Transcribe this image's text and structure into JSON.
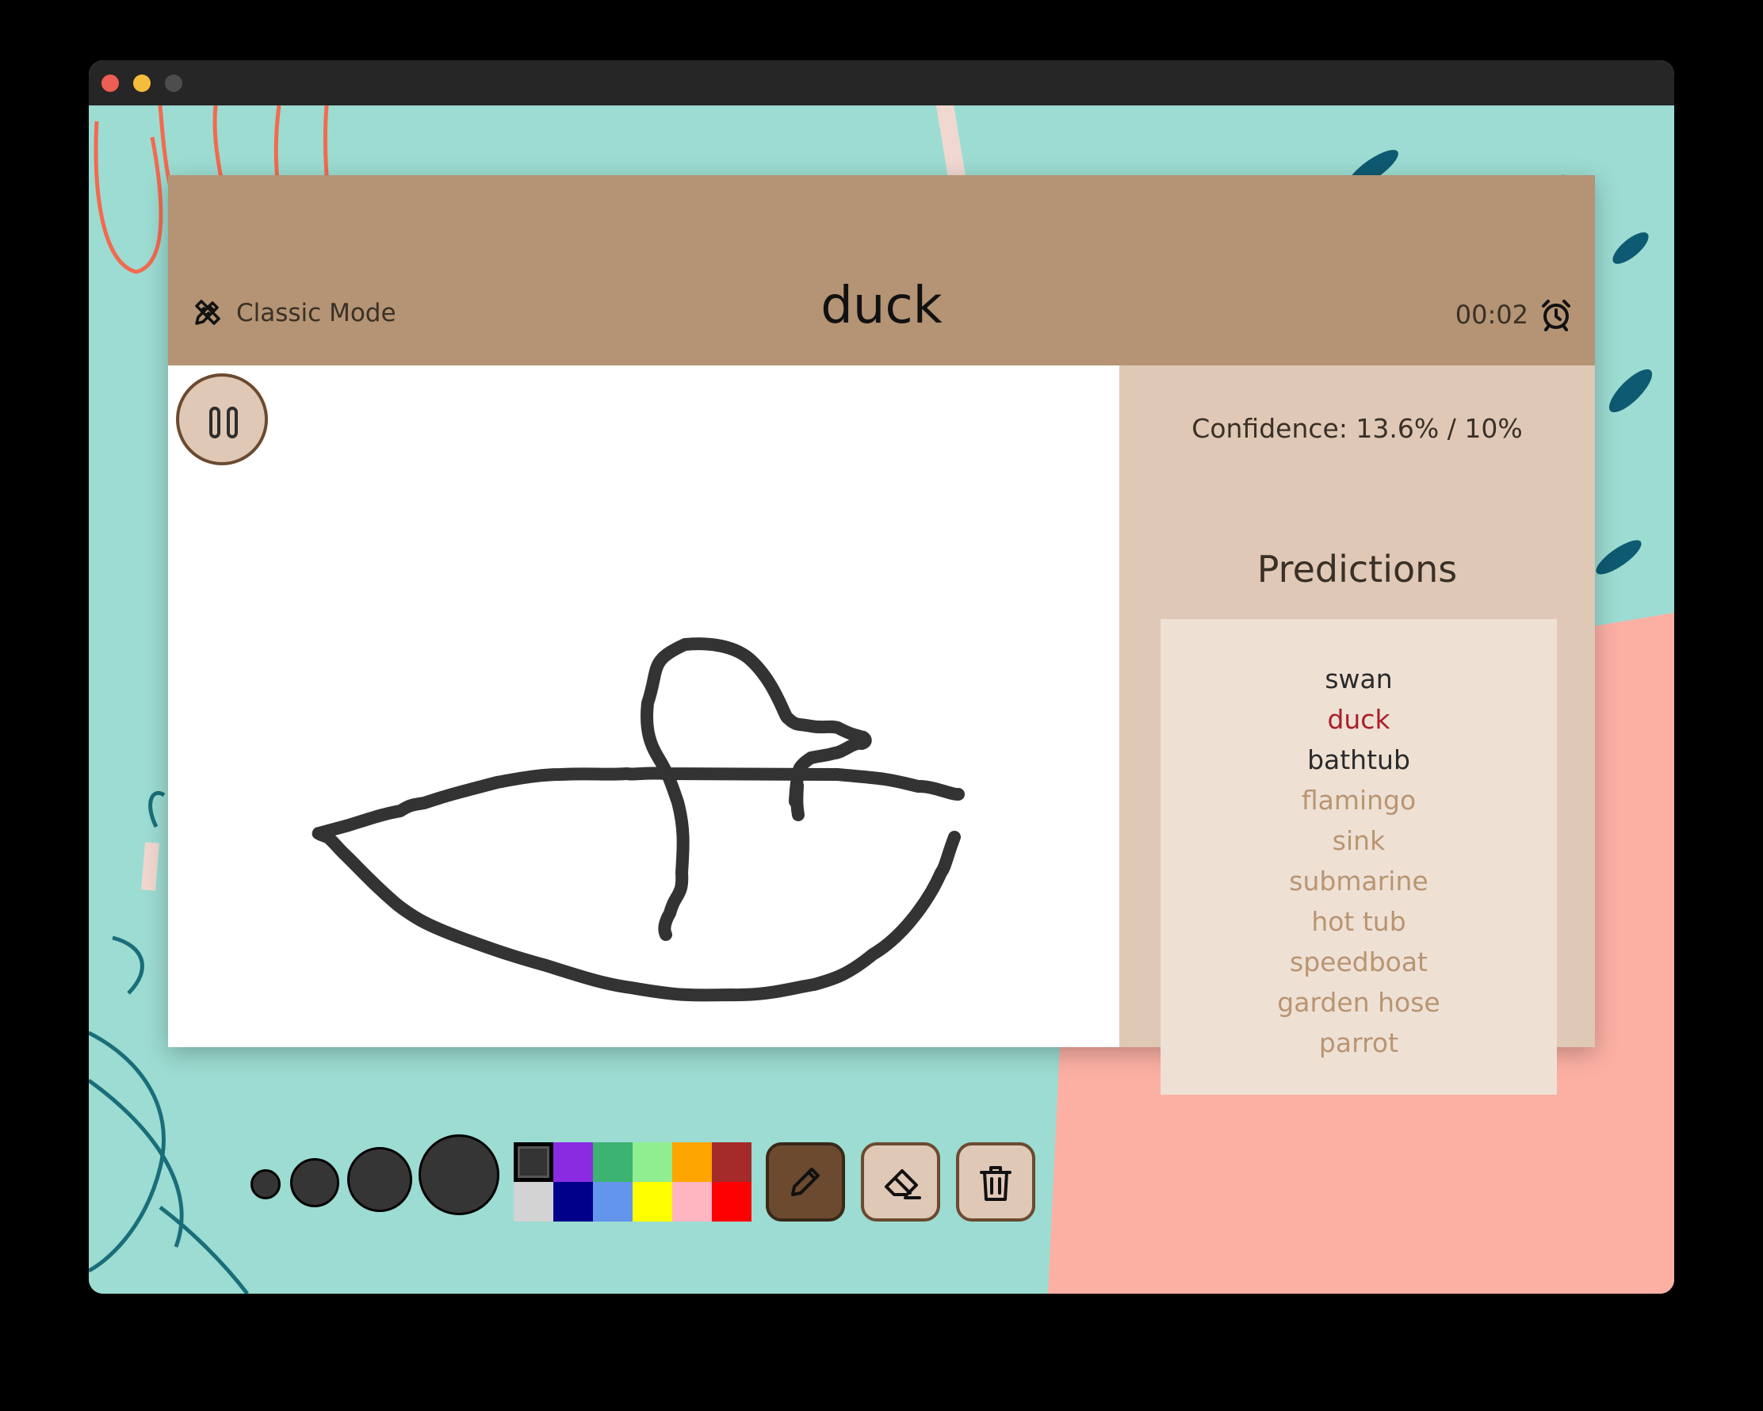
{
  "header": {
    "mode_label": "Classic Mode",
    "target_word": "duck",
    "timer": "00:02"
  },
  "sidebar": {
    "confidence": "Confidence: 13.6% / 10%",
    "predictions_title": "Predictions",
    "predictions": [
      {
        "label": "swan",
        "color": "#2a2a2a"
      },
      {
        "label": "duck",
        "color": "#a8202a"
      },
      {
        "label": "bathtub",
        "color": "#2a2a2a"
      },
      {
        "label": "flamingo",
        "color": "#b89572"
      },
      {
        "label": "sink",
        "color": "#b89572"
      },
      {
        "label": "submarine",
        "color": "#b89572"
      },
      {
        "label": "hot tub",
        "color": "#b89572"
      },
      {
        "label": "speedboat",
        "color": "#b89572"
      },
      {
        "label": "garden hose",
        "color": "#b89572"
      },
      {
        "label": "parrot",
        "color": "#b89572"
      }
    ]
  },
  "palette": {
    "selected": "#333333",
    "colors": [
      "#333333",
      "#8a2be2",
      "#3cb371",
      "#90ee90",
      "#ffa500",
      "#a52a2a",
      "#d3d3d3",
      "#00008b",
      "#6495ed",
      "#ffff00",
      "#ffb6c1",
      "#ff0000"
    ]
  },
  "brushes": [
    "small",
    "medium",
    "large",
    "extra-large"
  ],
  "icons": {
    "mode": "pencil-ruler-icon",
    "timer": "alarm-clock-icon",
    "pause": "pause-icon",
    "pen": "pencil-icon",
    "eraser": "eraser-icon",
    "clear": "trash-icon"
  },
  "theme": {
    "header_bg": "#b49474",
    "sidebar_bg": "#e0c8b6",
    "list_bg": "#efe0d4",
    "accent_dark": "#6b4a30",
    "background_teal": "#9cdcd2",
    "background_coral": "#fcb0a4"
  }
}
